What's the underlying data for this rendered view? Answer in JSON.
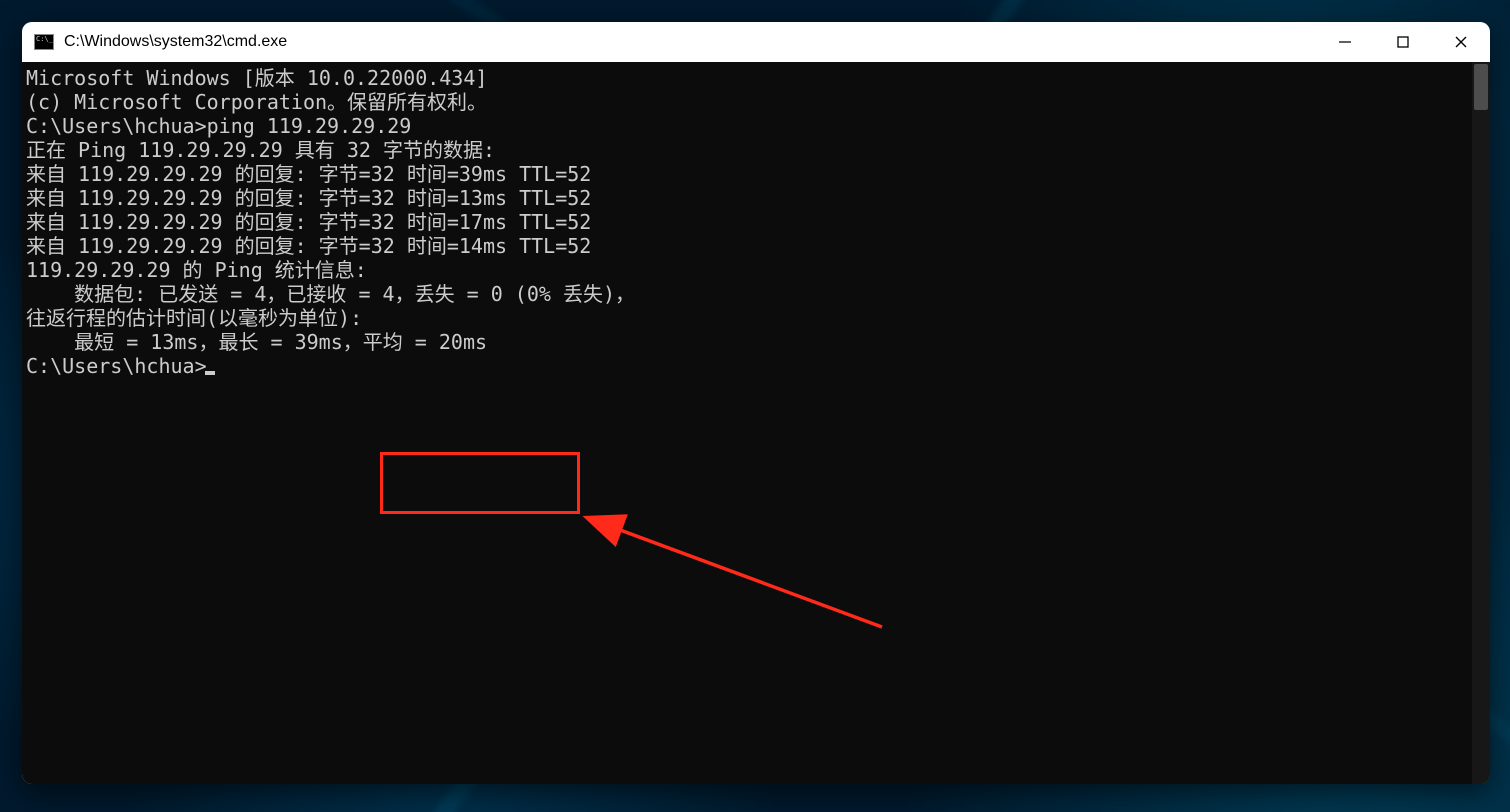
{
  "window": {
    "title": "C:\\Windows\\system32\\cmd.exe"
  },
  "terminal": {
    "lines": [
      "Microsoft Windows [版本 10.0.22000.434]",
      "(c) Microsoft Corporation。保留所有权利。",
      "",
      "C:\\Users\\hchua>ping 119.29.29.29",
      "",
      "正在 Ping 119.29.29.29 具有 32 字节的数据:",
      "来自 119.29.29.29 的回复: 字节=32 时间=39ms TTL=52",
      "来自 119.29.29.29 的回复: 字节=32 时间=13ms TTL=52",
      "来自 119.29.29.29 的回复: 字节=32 时间=17ms TTL=52",
      "来自 119.29.29.29 的回复: 字节=32 时间=14ms TTL=52",
      "",
      "119.29.29.29 的 Ping 统计信息:",
      "    数据包: 已发送 = 4，已接收 = 4，丢失 = 0 (0% 丢失)，",
      "往返行程的估计时间(以毫秒为单位):",
      "    最短 = 13ms，最长 = 39ms，平均 = 20ms",
      "",
      "C:\\Users\\hchua>"
    ],
    "prompt_index_with_cursor": 16
  },
  "annotation": {
    "highlighted_text": "平均 = 20ms"
  }
}
